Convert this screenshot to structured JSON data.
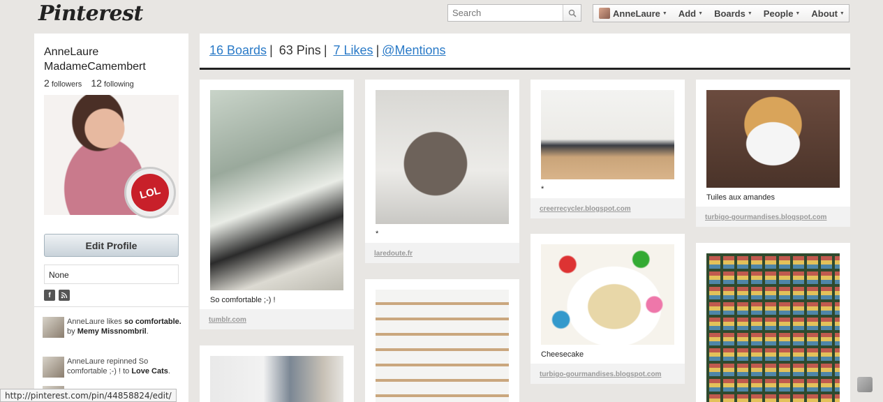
{
  "header": {
    "logo": "Pinterest",
    "search_placeholder": "Search",
    "nav": {
      "user": "AnneLaure",
      "add": "Add",
      "boards": "Boards",
      "people": "People",
      "about": "About"
    }
  },
  "profile": {
    "name": "AnneLaure MadameCamembert",
    "followers_count": "2",
    "followers_label": "followers",
    "following_count": "12",
    "following_label": "following",
    "badge_text": "LOL",
    "edit_profile": "Edit Profile",
    "location": "None"
  },
  "activity": [
    {
      "pre": "AnneLaure likes ",
      "bold1": "so comfortable.",
      "mid": " by ",
      "bold2": "Memy Missnombril",
      "post": "."
    },
    {
      "pre": "AnneLaure repinned So comfortable ;-) ! to ",
      "bold1": "Love Cats",
      "mid": "",
      "bold2": "",
      "post": "."
    }
  ],
  "tabs": {
    "boards": "16 Boards",
    "pins": "63 Pins",
    "likes": "7 Likes",
    "mentions": "@Mentions"
  },
  "pins": [
    {
      "desc": "So comfortable ;-) !",
      "source": "tumblr.com"
    },
    {
      "desc": "*",
      "source": "laredoute.fr"
    },
    {
      "desc": "*",
      "source": "creerrecycler.blogspot.com"
    },
    {
      "desc": "Tuiles aux amandes",
      "source": "turbigo-gourmandises.blogspot.com"
    },
    {
      "desc": "Cheesecake",
      "source": "turbigo-gourmandises.blogspot.com"
    }
  ],
  "statusbar": "http://pinterest.com/pin/44858824/edit/",
  "colors": {
    "link": "#2a7ac7",
    "background": "#e8e6e3",
    "badge_red": "#c8202a"
  }
}
